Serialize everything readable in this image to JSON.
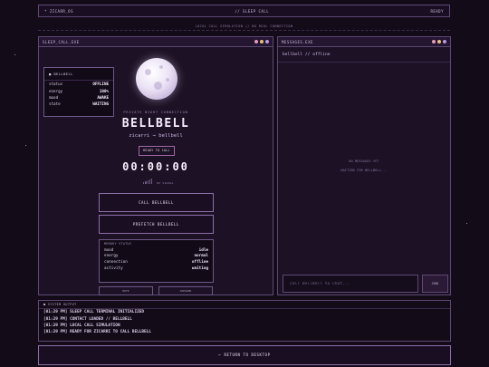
{
  "topbar": {
    "left_label": "* ZICARR_OS",
    "center_label": "// SLEEP CALL",
    "right_label": "READY"
  },
  "subbar": {
    "text": "LOCAL CALL SIMULATION // NO REAL CONNECTION"
  },
  "sleep_window": {
    "title": "SLEEP_CALL.EXE",
    "status_box": {
      "title": "BELLBELL",
      "rows": [
        {
          "k": "status",
          "v": "OFFLINE"
        },
        {
          "k": "energy",
          "v": "100%"
        },
        {
          "k": "mood",
          "v": "AWAKE"
        },
        {
          "k": "state",
          "v": "WAITING"
        }
      ]
    },
    "caption": "PRIVATE NIGHT CONNECTION",
    "contact_name": "BELLBELL",
    "route": "zicarri → bellbell",
    "ready_label": "READY TO CALL",
    "timer": "00:00:00",
    "signal_label": "NO SIGNAL",
    "call_button": "CALL BELLBELL",
    "prefill_button": "PREFETCH BELLBELL",
    "memory": {
      "title": "MEMORY STATUS",
      "rows": [
        {
          "k": "mood",
          "v": "idle"
        },
        {
          "k": "energy",
          "v": "normal"
        },
        {
          "k": "connection",
          "v": "offline"
        },
        {
          "k": "activity",
          "v": "waiting"
        }
      ]
    },
    "mini_buttons": [
      "MUTE",
      "SPEAKER"
    ]
  },
  "messages_window": {
    "title": "MESSAGES.EXE",
    "handle": "bellbell // offline",
    "empty_line1": "NO MESSAGES YET",
    "empty_line2": "WAITING FOR BELLBELL...",
    "input_placeholder": "call BellBell to chat...",
    "send_label": "SEND"
  },
  "system_log": {
    "title": "■ SYSTEM OUTPUT",
    "lines": [
      "[01:29 PM] SLEEP CALL TERMINAL INITIALIZED",
      "[01:29 PM] CONTACT LOADED // BELLBELL",
      "[01:29 PM] LOCAL CALL SIMULATION",
      "[01:29 PM] READY FOR ZICARRI TO CALL BELLBELL"
    ]
  },
  "return_button": "← RETURN TO DESKTOP",
  "colors": {
    "dot_pink": "#e79bb9",
    "dot_amber": "#e6c27a",
    "dot_violet": "#b59ae6",
    "accent": "#8c6fa6",
    "background": "#140b19"
  }
}
